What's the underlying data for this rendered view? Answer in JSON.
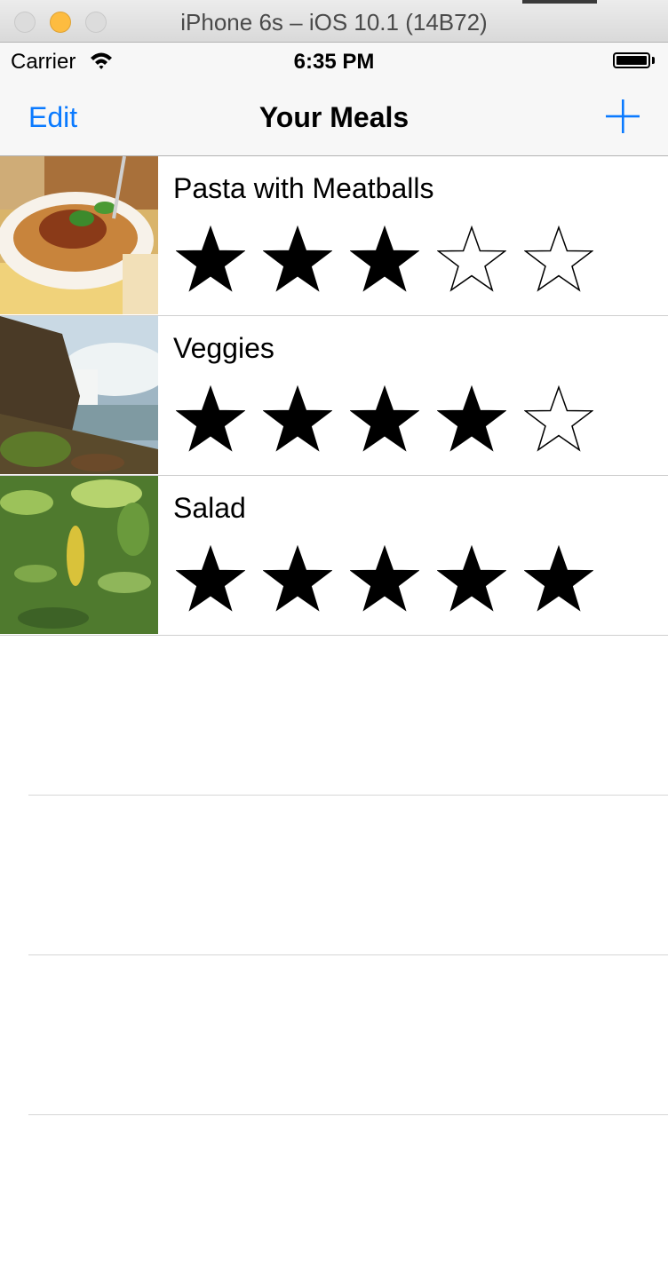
{
  "window": {
    "title": "iPhone 6s – iOS 10.1 (14B72)"
  },
  "status_bar": {
    "carrier": "Carrier",
    "time": "6:35 PM"
  },
  "nav": {
    "edit_label": "Edit",
    "title": "Your Meals",
    "add_icon": "plus-icon"
  },
  "colors": {
    "tint": "#0a7aff",
    "separator": "#cfcfcf"
  },
  "meals": [
    {
      "name": "Pasta with Meatballs",
      "rating": 3,
      "max_rating": 5,
      "photo": "pasta-photo"
    },
    {
      "name": "Veggies",
      "rating": 4,
      "max_rating": 5,
      "photo": "waterfall-photo"
    },
    {
      "name": "Salad",
      "rating": 5,
      "max_rating": 5,
      "photo": "leaves-photo"
    }
  ]
}
